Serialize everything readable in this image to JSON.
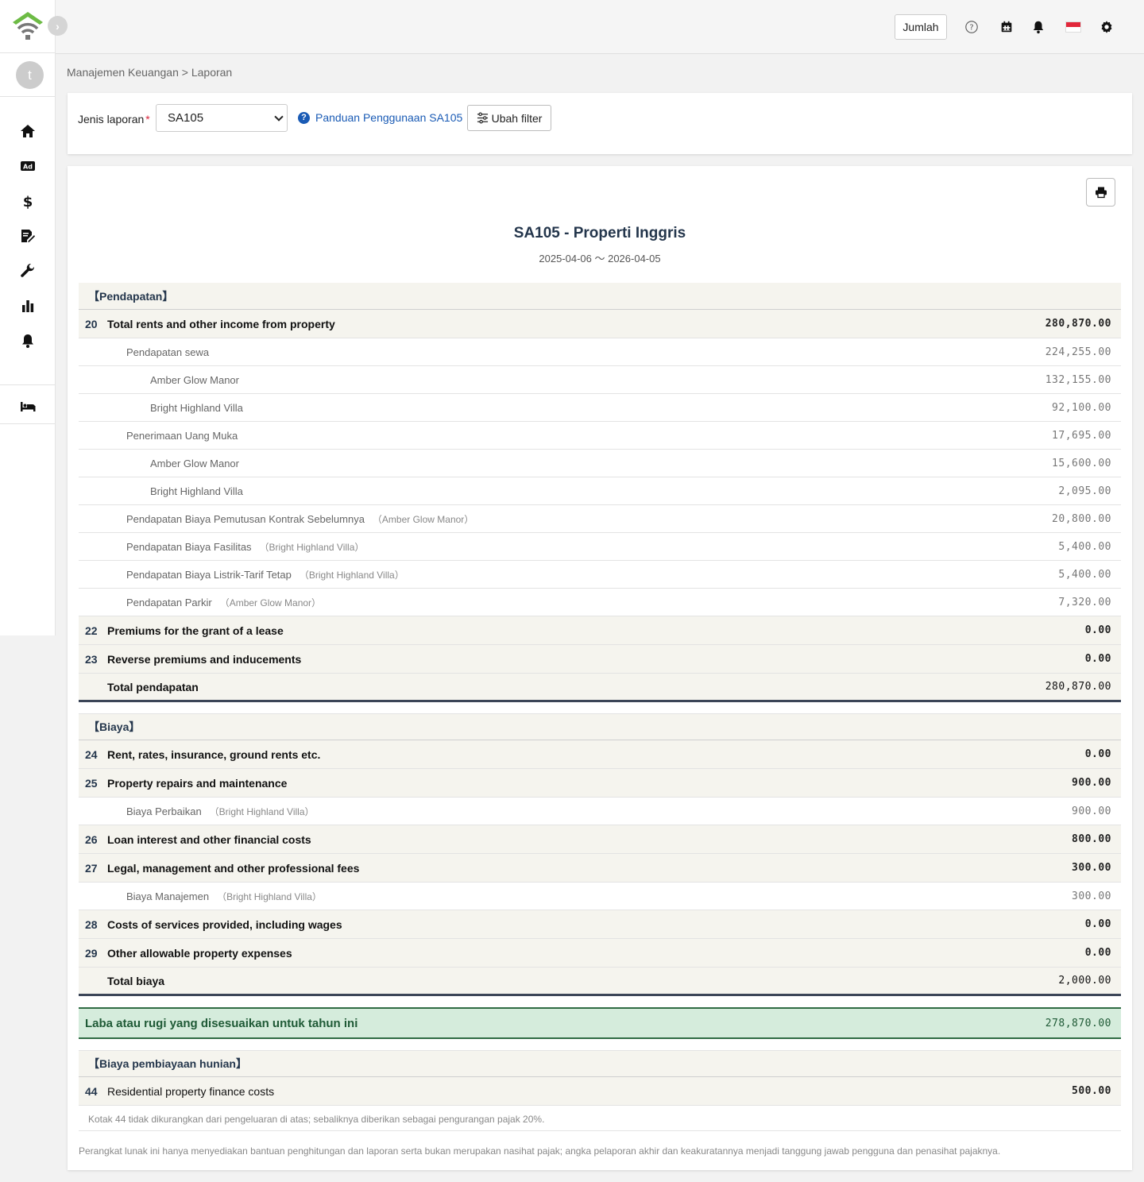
{
  "header": {
    "jumlah_label": "Jumlah",
    "flag_colors": [
      "#e2283b",
      "#ffffff"
    ]
  },
  "sidebar": {
    "avatar_initial": "t",
    "expand_glyph": "›",
    "items": [
      "home-icon",
      "ad-icon",
      "dollar-icon",
      "contract-icon",
      "wrench-icon",
      "chart-icon",
      "bell-icon",
      "bed-icon"
    ]
  },
  "breadcrumb": "Manajemen Keuangan > Laporan",
  "filter": {
    "label": "Jenis laporan",
    "required_mark": "*",
    "selected": "SA105",
    "guide_link": "Panduan Penggunaan SA105",
    "change_filter": "Ubah filter"
  },
  "report": {
    "title": "SA105 - Properti Inggris",
    "period": "2025-04-06 〜 2026-04-05",
    "income_section": "【Pendapatan】",
    "income_rows": [
      {
        "type": "main",
        "num": "20",
        "label": "Total rents and other income from property",
        "value": "280,870.00"
      },
      {
        "type": "sub1",
        "label": "Pendapatan sewa",
        "prop": "",
        "value": "224,255.00"
      },
      {
        "type": "sub2",
        "label": "Amber Glow Manor",
        "prop": "",
        "value": "132,155.00"
      },
      {
        "type": "sub2",
        "label": "Bright Highland Villa",
        "prop": "",
        "value": "92,100.00"
      },
      {
        "type": "sub1",
        "label": "Penerimaan Uang Muka",
        "prop": "",
        "value": "17,695.00"
      },
      {
        "type": "sub2",
        "label": "Amber Glow Manor",
        "prop": "",
        "value": "15,600.00"
      },
      {
        "type": "sub2",
        "label": "Bright Highland Villa",
        "prop": "",
        "value": "2,095.00"
      },
      {
        "type": "sub1",
        "label": "Pendapatan Biaya Pemutusan Kontrak Sebelumnya",
        "prop": "（Amber Glow Manor）",
        "value": "20,800.00"
      },
      {
        "type": "sub1",
        "label": "Pendapatan Biaya Fasilitas",
        "prop": "（Bright Highland Villa）",
        "value": "5,400.00"
      },
      {
        "type": "sub1",
        "label": "Pendapatan Biaya Listrik-Tarif Tetap",
        "prop": "（Bright Highland Villa）",
        "value": "5,400.00"
      },
      {
        "type": "sub1",
        "label": "Pendapatan Parkir",
        "prop": "（Amber Glow Manor）",
        "value": "7,320.00"
      },
      {
        "type": "main",
        "num": "22",
        "label": "Premiums for the grant of a lease",
        "value": "0.00"
      },
      {
        "type": "main",
        "num": "23",
        "label": "Reverse premiums and inducements",
        "value": "0.00"
      }
    ],
    "income_total_label": "Total pendapatan",
    "income_total_value": "280,870.00",
    "expense_section": "【Biaya】",
    "expense_rows": [
      {
        "type": "main",
        "num": "24",
        "label": "Rent, rates, insurance, ground rents etc.",
        "value": "0.00"
      },
      {
        "type": "main",
        "num": "25",
        "label": "Property repairs and maintenance",
        "value": "900.00"
      },
      {
        "type": "sub1",
        "label": "Biaya Perbaikan",
        "prop": "（Bright Highland Villa）",
        "value": "900.00"
      },
      {
        "type": "main",
        "num": "26",
        "label": "Loan interest and other financial costs",
        "value": "800.00"
      },
      {
        "type": "main",
        "num": "27",
        "label": "Legal, management and other professional fees",
        "value": "300.00"
      },
      {
        "type": "sub1",
        "label": "Biaya Manajemen",
        "prop": "（Bright Highland Villa）",
        "value": "300.00"
      },
      {
        "type": "main",
        "num": "28",
        "label": "Costs of services provided, including wages",
        "value": "0.00"
      },
      {
        "type": "main",
        "num": "29",
        "label": "Other allowable property expenses",
        "value": "0.00"
      }
    ],
    "expense_total_label": "Total biaya",
    "expense_total_value": "2,000.00",
    "profit_label": "Laba atau rugi yang disesuaikan untuk tahun ini",
    "profit_value": "278,870.00",
    "finance_section": "【Biaya pembiayaan hunian】",
    "finance_row": {
      "num": "44",
      "label": "Residential property finance costs",
      "value": "500.00"
    },
    "finance_note": "Kotak 44 tidak dikurangkan dari pengeluaran di atas; sebaliknya diberikan sebagai pengurangan pajak 20%.",
    "disclaimer": "Perangkat lunak ini hanya menyediakan bantuan penghitungan dan laporan serta bukan merupakan nasihat pajak; angka pelaporan akhir dan keakuratannya menjadi tanggung jawab pengguna dan penasihat pajaknya."
  }
}
